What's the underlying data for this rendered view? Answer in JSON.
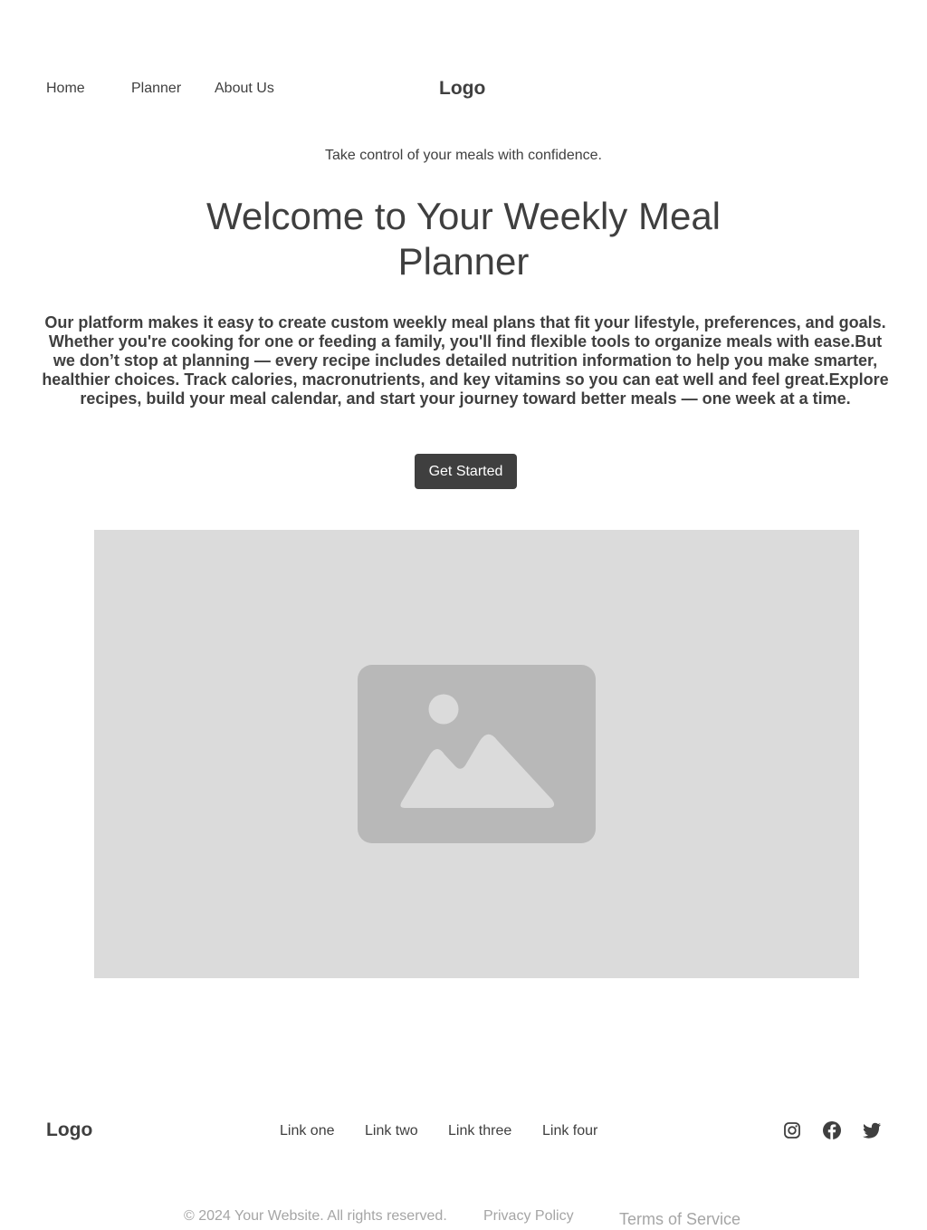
{
  "header": {
    "nav": [
      {
        "label": "Home"
      },
      {
        "label": "Planner"
      },
      {
        "label": "About Us"
      }
    ],
    "logo": "Logo"
  },
  "hero": {
    "tagline": "Take control of your meals with confidence.",
    "title": "Welcome to Your Weekly Meal Planner",
    "description": "Our platform makes it easy to create custom weekly meal plans that fit your lifestyle, preferences, and goals. Whether you're cooking for one or feeding a family, you'll find flexible tools to organize meals with ease.But we don’t stop at planning — every recipe includes detailed nutrition information to help you make smarter, healthier choices. Track calories, macronutrients, and key vitamins so you can eat well and feel great.Explore recipes, build your meal calendar, and start your journey toward better meals — one week at a time.",
    "cta_label": "Get Started"
  },
  "media": {
    "icon": "image-placeholder-icon"
  },
  "footer": {
    "logo": "Logo",
    "links": [
      {
        "label": "Link one"
      },
      {
        "label": "Link two"
      },
      {
        "label": "Link three"
      },
      {
        "label": "Link four"
      }
    ],
    "social": [
      {
        "icon": "instagram-icon"
      },
      {
        "icon": "facebook-icon"
      },
      {
        "icon": "twitter-icon"
      }
    ],
    "copyright": "© 2024 Your Website. All rights reserved.",
    "privacy": "Privacy Policy",
    "terms": "Terms of Service"
  },
  "colors": {
    "text": "#3f3f3f",
    "button_bg": "#3f3f3f",
    "button_text": "#ffffff",
    "placeholder_bg": "#dbdbdb",
    "placeholder_icon": "#b8b8b8",
    "muted_text": "#a5a5a5"
  }
}
